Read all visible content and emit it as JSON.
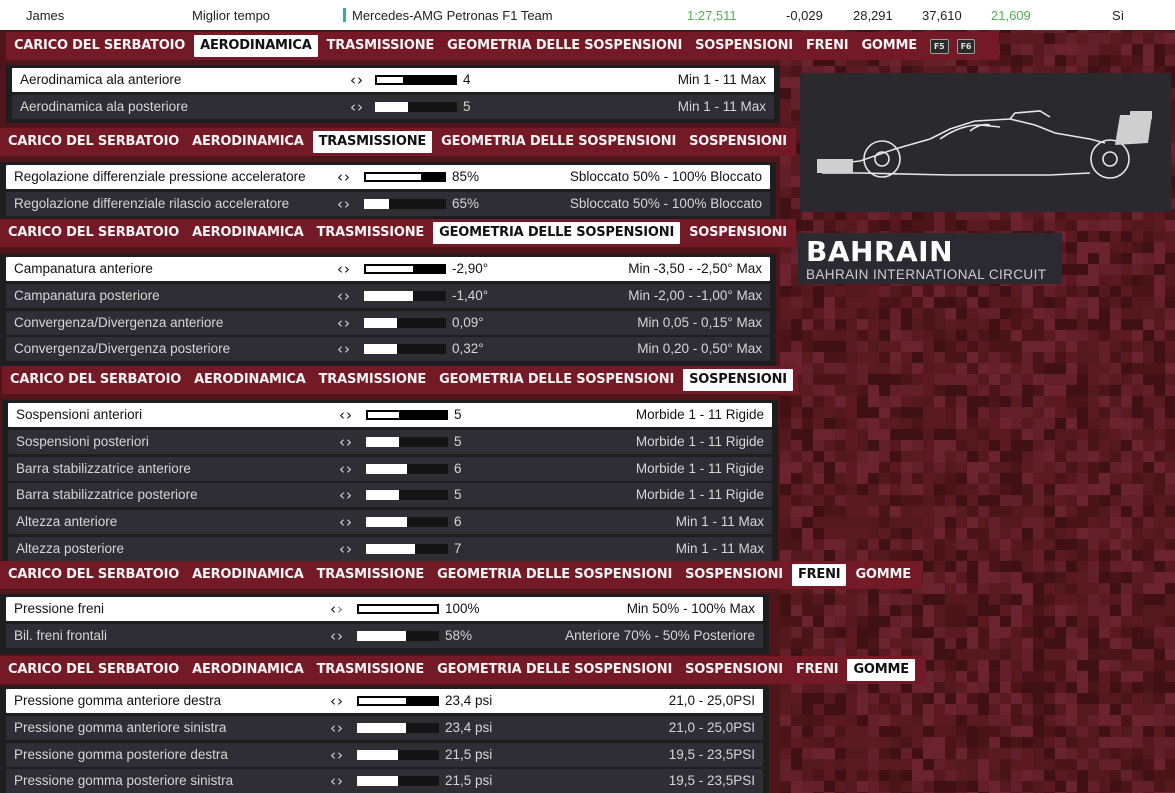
{
  "topbar": {
    "driver": "James",
    "label": "Miglior tempo",
    "team": "Mercedes-AMG Petronas F1 Team",
    "best_lap": "1:27,511",
    "delta": "-0,029",
    "s1": "28,291",
    "s2": "37,610",
    "s3": "21,609",
    "flag": "Sì"
  },
  "tabs": {
    "fuel": "CARICO DEL SERBATOIO",
    "aero": "AERODINAMICA",
    "trans": "TRASMISSIONE",
    "geom": "GEOMETRIA DELLE SOSPENSIONI",
    "susp": "SOSPENSIONI",
    "brakes": "FRENI",
    "tyres": "GOMME",
    "f5": "F5",
    "f6": "F6"
  },
  "aero": {
    "rows": [
      {
        "label": "Aerodinamica ala anteriore",
        "value": "4",
        "range": "Min 1 - 11 Max",
        "level": 0.33
      },
      {
        "label": "Aerodinamica ala posteriore",
        "value": "5",
        "range": "Min 1 - 11 Max",
        "level": 0.4
      }
    ]
  },
  "trans": {
    "rows": [
      {
        "label": "Regolazione differenziale pressione acceleratore",
        "value": "85%",
        "range": "Sbloccato 50% - 100% Bloccato",
        "level": 0.7
      },
      {
        "label": "Regolazione differenziale rilascio acceleratore",
        "value": "65%",
        "range": "Sbloccato 50% - 100% Bloccato",
        "level": 0.3
      }
    ]
  },
  "geom": {
    "rows": [
      {
        "label": "Campanatura anteriore",
        "value": "-2,90°",
        "range": "Min -3,50 - -2,50° Max",
        "level": 0.6
      },
      {
        "label": "Campanatura posteriore",
        "value": "-1,40°",
        "range": "Min -2,00 - -1,00° Max",
        "level": 0.6
      },
      {
        "label": "Convergenza/Divergenza anteriore",
        "value": "0,09°",
        "range": "Min 0,05 - 0,15° Max",
        "level": 0.4
      },
      {
        "label": "Convergenza/Divergenza posteriore",
        "value": "0,32°",
        "range": "Min 0,20 - 0,50° Max",
        "level": 0.4
      }
    ]
  },
  "susp": {
    "rows": [
      {
        "label": "Sospensioni anteriori",
        "value": "5",
        "range": "Morbide 1 - 11 Rigide",
        "level": 0.4
      },
      {
        "label": "Sospensioni posteriori",
        "value": "5",
        "range": "Morbide 1 - 11 Rigide",
        "level": 0.4
      },
      {
        "label": "Barra stabilizzatrice anteriore",
        "value": "6",
        "range": "Morbide 1 - 11 Rigide",
        "level": 0.5
      },
      {
        "label": "Barra stabilizzatrice posteriore",
        "value": "5",
        "range": "Morbide 1 - 11 Rigide",
        "level": 0.4
      },
      {
        "label": "Altezza anteriore",
        "value": "6",
        "range": "Min 1 - 11 Max",
        "level": 0.5
      },
      {
        "label": "Altezza posteriore",
        "value": "7",
        "range": "Min 1 - 11 Max",
        "level": 0.6
      }
    ]
  },
  "brakes": {
    "rows": [
      {
        "label": "Pressione freni",
        "value": "100%",
        "range": "Min 50% - 100% Max",
        "level": 1.0
      },
      {
        "label": "Bil. freni frontali",
        "value": "58%",
        "range": "Anteriore 70% - 50% Posteriore",
        "level": 0.6
      }
    ]
  },
  "tyres": {
    "rows": [
      {
        "label": "Pressione gomma anteriore destra",
        "value": "23,4 psi",
        "range": "21,0 - 25,0PSI",
        "level": 0.6
      },
      {
        "label": "Pressione gomma anteriore sinistra",
        "value": "23,4 psi",
        "range": "21,0 - 25,0PSI",
        "level": 0.6
      },
      {
        "label": "Pressione gomma posteriore destra",
        "value": "21,5 psi",
        "range": "19,5 - 23,5PSI",
        "level": 0.5
      },
      {
        "label": "Pressione gomma posteriore sinistra",
        "value": "21,5 psi",
        "range": "19,5 - 23,5PSI",
        "level": 0.5
      }
    ]
  },
  "track": {
    "name": "BAHRAIN",
    "circuit": "BAHRAIN INTERNATIONAL CIRCUIT"
  },
  "colors": {
    "tab_bg": "#741a26",
    "panel_bg": "#1e1e21",
    "row_bg": "#302e35",
    "accent_green": "#4fb04f",
    "team_teal": "#27b5a3"
  }
}
